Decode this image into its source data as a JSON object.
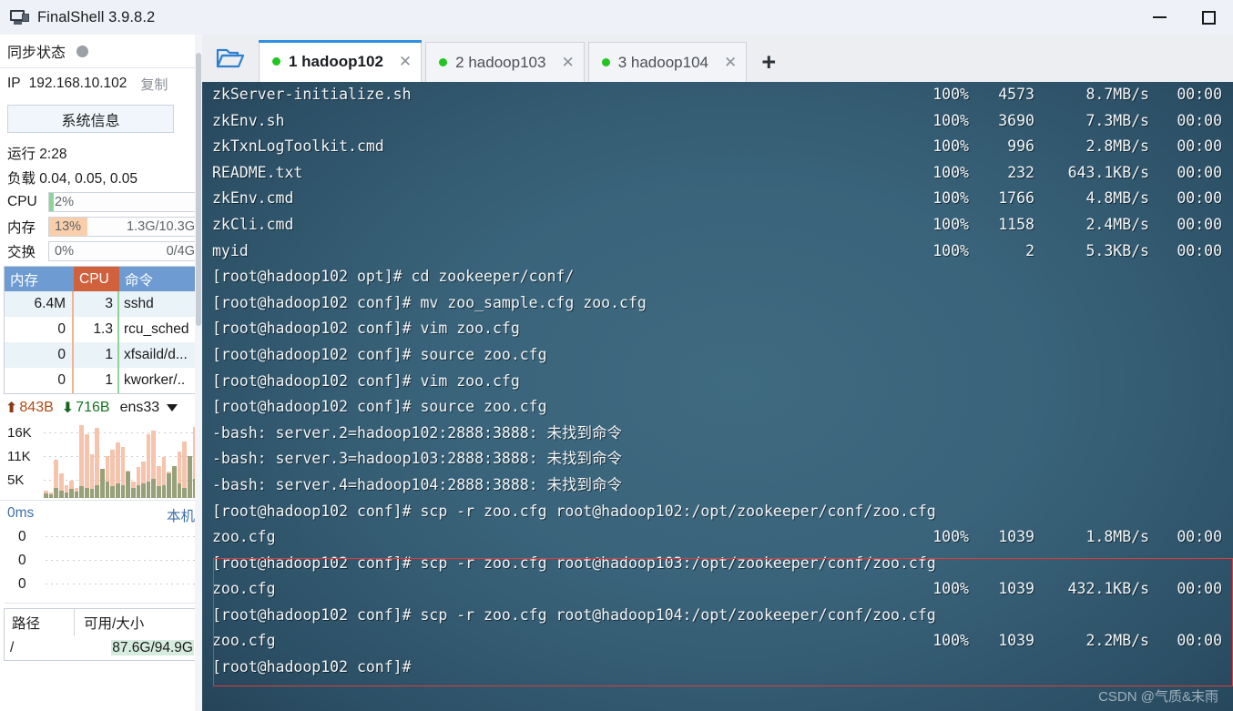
{
  "window": {
    "title": "FinalShell 3.9.8.2",
    "icon": "monitor-icon",
    "minimize_label": "—",
    "maximize_label": "□"
  },
  "sidebar": {
    "sync": {
      "label": "同步状态",
      "status_icon": "gray-dot-icon"
    },
    "ip": {
      "label": "IP",
      "value": "192.168.10.102",
      "copy_label": "复制"
    },
    "system_info_button": "系统信息",
    "uptime": "运行 2:28",
    "load": "负载 0.04, 0.05, 0.05",
    "meters": [
      {
        "label": "CPU",
        "percent": "2%",
        "right": "",
        "fill_pct": 2,
        "color": "#8fd39a"
      },
      {
        "label": "内存",
        "percent": "13%",
        "right": "1.3G/10.3G",
        "fill_pct": 13,
        "color": "#f7cba5"
      },
      {
        "label": "交换",
        "percent": "0%",
        "right": "0/4G",
        "fill_pct": 0,
        "color": "#f7cba5"
      }
    ],
    "process_table": {
      "headers": {
        "mem": "内存",
        "cpu": "CPU",
        "cmd": "命令"
      },
      "rows": [
        {
          "mem": "6.4M",
          "cpu": "3",
          "cmd": "sshd"
        },
        {
          "mem": "0",
          "cpu": "1.3",
          "cmd": "rcu_sched"
        },
        {
          "mem": "0",
          "cpu": "1",
          "cmd": "xfsaild/d..."
        },
        {
          "mem": "0",
          "cpu": "1",
          "cmd": "kworker/.."
        }
      ]
    },
    "network": {
      "up_icon": "arrow-up-icon",
      "up": "843B",
      "down_icon": "arrow-down-icon",
      "down": "716B",
      "interface": "ens33",
      "dropdown_icon": "caret-down-icon",
      "chart_yticks": [
        "16K",
        "11K",
        "5K"
      ]
    },
    "ping": {
      "latency": "0ms",
      "host": "本机",
      "yticks": [
        "0",
        "0",
        "0"
      ]
    },
    "disk": {
      "headers": {
        "path": "路径",
        "avail": "可用/大小"
      },
      "rows": [
        {
          "path": "/",
          "avail": "87.6G/94.9G"
        }
      ]
    }
  },
  "tabbar": {
    "folder_icon": "open-folder-icon",
    "add_icon": "plus-icon",
    "tabs": [
      {
        "label": "1 hadoop102",
        "active": true,
        "status_icon": "green-dot-icon",
        "close_icon": "close-icon"
      },
      {
        "label": "2 hadoop103",
        "active": false,
        "status_icon": "green-dot-icon",
        "close_icon": "close-icon"
      },
      {
        "label": "3 hadoop104",
        "active": false,
        "status_icon": "green-dot-icon",
        "close_icon": "close-icon"
      }
    ]
  },
  "terminal": {
    "lines": [
      {
        "text": "zkServer-initialize.sh",
        "pct": "100%",
        "size": "4573",
        "speed": "8.7MB/s",
        "time": "00:00"
      },
      {
        "text": "zkEnv.sh",
        "pct": "100%",
        "size": "3690",
        "speed": "7.3MB/s",
        "time": "00:00"
      },
      {
        "text": "zkTxnLogToolkit.cmd",
        "pct": "100%",
        "size": "996",
        "speed": "2.8MB/s",
        "time": "00:00"
      },
      {
        "text": "README.txt",
        "pct": "100%",
        "size": "232",
        "speed": "643.1KB/s",
        "time": "00:00"
      },
      {
        "text": "zkEnv.cmd",
        "pct": "100%",
        "size": "1766",
        "speed": "4.8MB/s",
        "time": "00:00"
      },
      {
        "text": "zkCli.cmd",
        "pct": "100%",
        "size": "1158",
        "speed": "2.4MB/s",
        "time": "00:00"
      },
      {
        "text": "myid",
        "pct": "100%",
        "size": "2",
        "speed": "5.3KB/s",
        "time": "00:00"
      },
      {
        "text": "[root@hadoop102 opt]# cd zookeeper/conf/"
      },
      {
        "text": "[root@hadoop102 conf]# mv zoo_sample.cfg zoo.cfg"
      },
      {
        "text": "[root@hadoop102 conf]# vim zoo.cfg"
      },
      {
        "text": "[root@hadoop102 conf]# source zoo.cfg"
      },
      {
        "text": "[root@hadoop102 conf]# vim zoo.cfg"
      },
      {
        "text": "[root@hadoop102 conf]# source zoo.cfg"
      },
      {
        "text": "-bash: server.2=hadoop102:2888:3888: 未找到命令"
      },
      {
        "text": "-bash: server.3=hadoop103:2888:3888: 未找到命令"
      },
      {
        "text": "-bash: server.4=hadoop104:2888:3888: 未找到命令"
      },
      {
        "text": "[root@hadoop102 conf]# scp -r zoo.cfg root@hadoop102:/opt/zookeeper/conf/zoo.cfg"
      },
      {
        "text": "zoo.cfg",
        "pct": "100%",
        "size": "1039",
        "speed": "1.8MB/s",
        "time": "00:00"
      },
      {
        "text": "[root@hadoop102 conf]# scp -r zoo.cfg root@hadoop103:/opt/zookeeper/conf/zoo.cfg"
      },
      {
        "text": "zoo.cfg",
        "pct": "100%",
        "size": "1039",
        "speed": "432.1KB/s",
        "time": "00:00"
      },
      {
        "text": "[root@hadoop102 conf]# scp -r zoo.cfg root@hadoop104:/opt/zookeeper/conf/zoo.cfg"
      },
      {
        "text": "zoo.cfg",
        "pct": "100%",
        "size": "1039",
        "speed": "2.2MB/s",
        "time": "00:00"
      },
      {
        "text": "[root@hadoop102 conf]#"
      }
    ],
    "highlight_box": {
      "start_line": 18,
      "end_line": 22,
      "color": "#e03a3a"
    },
    "watermark": "CSDN @气质&末雨"
  },
  "colors": {
    "accent": "#2f8fe0",
    "terminal_bg": "#3a6478",
    "tab_active_bg": "#ffffff",
    "status_green": "#21c521",
    "highlight_red": "#e03a3a"
  }
}
